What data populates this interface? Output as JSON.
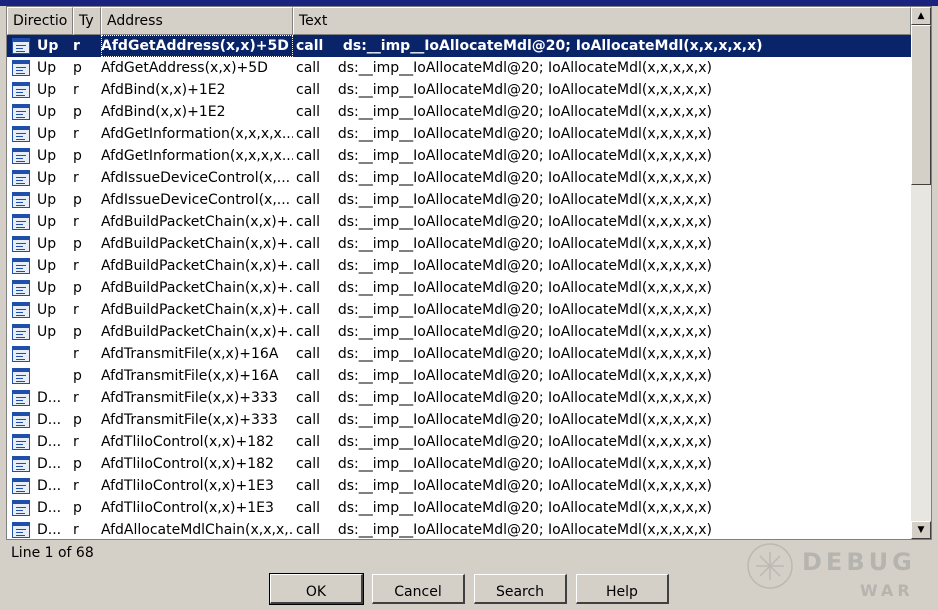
{
  "list": {
    "columns": [
      "Directio",
      "Ty",
      "Address",
      "Text"
    ],
    "rows": [
      {
        "direction": "Up",
        "type": "r",
        "address": "AfdGetAddress(x,x)+5D",
        "text": "call    ds:__imp__IoAllocateMdl@20; IoAllocateMdl(x,x,x,x,x)",
        "selected": true
      },
      {
        "direction": "Up",
        "type": "p",
        "address": "AfdGetAddress(x,x)+5D",
        "text": "call    ds:__imp__IoAllocateMdl@20; IoAllocateMdl(x,x,x,x,x)"
      },
      {
        "direction": "Up",
        "type": "r",
        "address": "AfdBind(x,x)+1E2",
        "text": "call    ds:__imp__IoAllocateMdl@20; IoAllocateMdl(x,x,x,x,x)"
      },
      {
        "direction": "Up",
        "type": "p",
        "address": "AfdBind(x,x)+1E2",
        "text": "call    ds:__imp__IoAllocateMdl@20; IoAllocateMdl(x,x,x,x,x)"
      },
      {
        "direction": "Up",
        "type": "r",
        "address": "AfdGetInformation(x,x,x,x...",
        "text": "call    ds:__imp__IoAllocateMdl@20; IoAllocateMdl(x,x,x,x,x)"
      },
      {
        "direction": "Up",
        "type": "p",
        "address": "AfdGetInformation(x,x,x,x...",
        "text": "call    ds:__imp__IoAllocateMdl@20; IoAllocateMdl(x,x,x,x,x)"
      },
      {
        "direction": "Up",
        "type": "r",
        "address": "AfdIssueDeviceControl(x,...",
        "text": "call    ds:__imp__IoAllocateMdl@20; IoAllocateMdl(x,x,x,x,x)"
      },
      {
        "direction": "Up",
        "type": "p",
        "address": "AfdIssueDeviceControl(x,...",
        "text": "call    ds:__imp__IoAllocateMdl@20; IoAllocateMdl(x,x,x,x,x)"
      },
      {
        "direction": "Up",
        "type": "r",
        "address": "AfdBuildPacketChain(x,x)+...",
        "text": "call    ds:__imp__IoAllocateMdl@20; IoAllocateMdl(x,x,x,x,x)"
      },
      {
        "direction": "Up",
        "type": "p",
        "address": "AfdBuildPacketChain(x,x)+...",
        "text": "call    ds:__imp__IoAllocateMdl@20; IoAllocateMdl(x,x,x,x,x)"
      },
      {
        "direction": "Up",
        "type": "r",
        "address": "AfdBuildPacketChain(x,x)+...",
        "text": "call    ds:__imp__IoAllocateMdl@20; IoAllocateMdl(x,x,x,x,x)"
      },
      {
        "direction": "Up",
        "type": "p",
        "address": "AfdBuildPacketChain(x,x)+...",
        "text": "call    ds:__imp__IoAllocateMdl@20; IoAllocateMdl(x,x,x,x,x)"
      },
      {
        "direction": "Up",
        "type": "r",
        "address": "AfdBuildPacketChain(x,x)+...",
        "text": "call    ds:__imp__IoAllocateMdl@20; IoAllocateMdl(x,x,x,x,x)"
      },
      {
        "direction": "Up",
        "type": "p",
        "address": "AfdBuildPacketChain(x,x)+...",
        "text": "call    ds:__imp__IoAllocateMdl@20; IoAllocateMdl(x,x,x,x,x)"
      },
      {
        "direction": "",
        "type": "r",
        "address": "AfdTransmitFile(x,x)+16A",
        "text": "call    ds:__imp__IoAllocateMdl@20; IoAllocateMdl(x,x,x,x,x)"
      },
      {
        "direction": "",
        "type": "p",
        "address": "AfdTransmitFile(x,x)+16A",
        "text": "call    ds:__imp__IoAllocateMdl@20; IoAllocateMdl(x,x,x,x,x)"
      },
      {
        "direction": "D...",
        "type": "r",
        "address": "AfdTransmitFile(x,x)+333",
        "text": "call    ds:__imp__IoAllocateMdl@20; IoAllocateMdl(x,x,x,x,x)"
      },
      {
        "direction": "D...",
        "type": "p",
        "address": "AfdTransmitFile(x,x)+333",
        "text": "call    ds:__imp__IoAllocateMdl@20; IoAllocateMdl(x,x,x,x,x)"
      },
      {
        "direction": "D...",
        "type": "r",
        "address": "AfdTliIoControl(x,x)+182",
        "text": "call    ds:__imp__IoAllocateMdl@20; IoAllocateMdl(x,x,x,x,x)"
      },
      {
        "direction": "D...",
        "type": "p",
        "address": "AfdTliIoControl(x,x)+182",
        "text": "call    ds:__imp__IoAllocateMdl@20; IoAllocateMdl(x,x,x,x,x)"
      },
      {
        "direction": "D...",
        "type": "r",
        "address": "AfdTliIoControl(x,x)+1E3",
        "text": "call    ds:__imp__IoAllocateMdl@20; IoAllocateMdl(x,x,x,x,x)"
      },
      {
        "direction": "D...",
        "type": "p",
        "address": "AfdTliIoControl(x,x)+1E3",
        "text": "call    ds:__imp__IoAllocateMdl@20; IoAllocateMdl(x,x,x,x,x)"
      },
      {
        "direction": "D...",
        "type": "r",
        "address": "AfdAllocateMdlChain(x,x,x,...",
        "text": "call    ds:__imp__IoAllocateMdl@20; IoAllocateMdl(x,x,x,x,x)"
      }
    ],
    "row_icon": "code-reference-icon"
  },
  "status": {
    "text": "Line 1 of 68"
  },
  "buttons": {
    "ok": "OK",
    "cancel": "Cancel",
    "search": "Search",
    "help": "Help"
  },
  "watermark": {
    "brand": "DEBUG",
    "sub": "WAR"
  },
  "colors": {
    "selection": "#0a246a",
    "dialog_bg": "#d4d0c8",
    "icon_blue": "#1f4fa8"
  }
}
